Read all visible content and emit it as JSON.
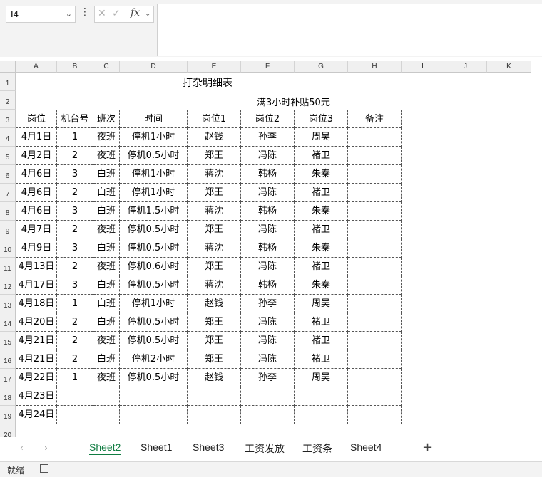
{
  "formula_bar": {
    "name_box": "I4",
    "fx": "fx",
    "formula_value": ""
  },
  "columns": [
    "A",
    "B",
    "C",
    "D",
    "E",
    "F",
    "G",
    "H",
    "I",
    "J",
    "K"
  ],
  "rows": [
    "1",
    "2",
    "3",
    "4",
    "5",
    "6",
    "7",
    "8",
    "9",
    "10",
    "11",
    "12",
    "13",
    "14",
    "15",
    "16",
    "17",
    "18",
    "19",
    "20"
  ],
  "sheet": {
    "title": "打杂明细表",
    "note": "满3小时补贴50元",
    "headers": [
      "岗位",
      "机台号",
      "班次",
      "时间",
      "岗位1",
      "岗位2",
      "岗位3",
      "备注"
    ],
    "data": [
      [
        "4月1日",
        "1",
        "夜班",
        "停机1小时",
        "赵钱",
        "孙李",
        "周吴",
        ""
      ],
      [
        "4月2日",
        "2",
        "夜班",
        "停机0.5小时",
        "郑王",
        "冯陈",
        "褚卫",
        ""
      ],
      [
        "4月6日",
        "3",
        "白班",
        "停机1小时",
        "蒋沈",
        "韩杨",
        "朱秦",
        ""
      ],
      [
        "4月6日",
        "2",
        "白班",
        "停机1小时",
        "郑王",
        "冯陈",
        "褚卫",
        ""
      ],
      [
        "4月6日",
        "3",
        "白班",
        "停机1.5小时",
        "蒋沈",
        "韩杨",
        "朱秦",
        ""
      ],
      [
        "4月7日",
        "2",
        "夜班",
        "停机0.5小时",
        "郑王",
        "冯陈",
        "褚卫",
        ""
      ],
      [
        "4月9日",
        "3",
        "白班",
        "停机0.5小时",
        "蒋沈",
        "韩杨",
        "朱秦",
        ""
      ],
      [
        "4月13日",
        "2",
        "夜班",
        "停机0.6小时",
        "郑王",
        "冯陈",
        "褚卫",
        ""
      ],
      [
        "4月17日",
        "3",
        "白班",
        "停机0.5小时",
        "蒋沈",
        "韩杨",
        "朱秦",
        ""
      ],
      [
        "4月18日",
        "1",
        "白班",
        "停机1小时",
        "赵钱",
        "孙李",
        "周吴",
        ""
      ],
      [
        "4月20日",
        "2",
        "白班",
        "停机0.5小时",
        "郑王",
        "冯陈",
        "褚卫",
        ""
      ],
      [
        "4月21日",
        "2",
        "夜班",
        "停机0.5小时",
        "郑王",
        "冯陈",
        "褚卫",
        ""
      ],
      [
        "4月21日",
        "2",
        "白班",
        "停机2小时",
        "郑王",
        "冯陈",
        "褚卫",
        ""
      ],
      [
        "4月22日",
        "1",
        "夜班",
        "停机0.5小时",
        "赵钱",
        "孙李",
        "周吴",
        ""
      ],
      [
        "4月23日",
        "",
        "",
        "",
        "",
        "",
        "",
        ""
      ],
      [
        "4月24日",
        "",
        "",
        "",
        "",
        "",
        "",
        ""
      ]
    ]
  },
  "tabs": [
    "Sheet2",
    "Sheet1",
    "Sheet3",
    "工资发放",
    "工资条",
    "Sheet4"
  ],
  "active_tab": "Sheet2",
  "status": {
    "ready": "就绪"
  },
  "colors": {
    "accent": "#107c41",
    "header_bg": "#f0f0f0"
  }
}
